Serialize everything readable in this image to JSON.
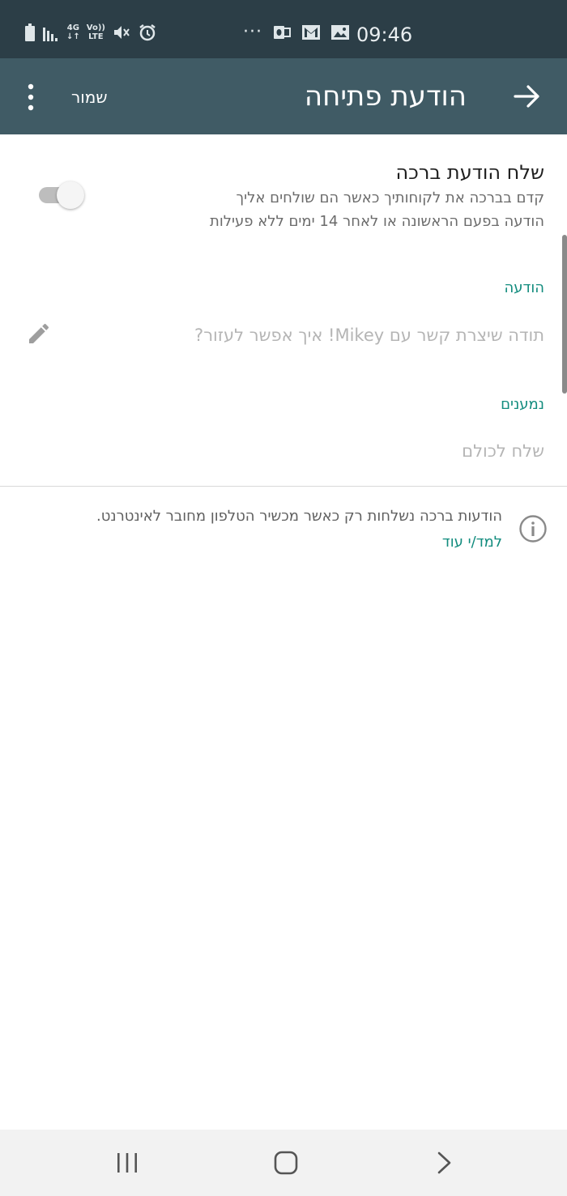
{
  "status_bar": {
    "time": "09:46",
    "network_label": "4G",
    "volte_label": "Vo))\nLTE",
    "icons": [
      "battery-icon",
      "signal-icon",
      "network-icon",
      "volte-icon",
      "mute-icon",
      "alarm-icon",
      "more-notifications-icon",
      "outlook-icon",
      "gmail-icon",
      "gallery-icon"
    ],
    "dots": "···"
  },
  "toolbar": {
    "title": "הודעת פתיחה",
    "save_label": "שמור",
    "background": "#405b65"
  },
  "greeting_setting": {
    "title": "שלח הודעת ברכה",
    "description": "קדם בברכה את לקוחותיך כאשר הם שולחים אליך הודעה בפעם הראשונה או לאחר 14 ימים ללא פעילות",
    "enabled": false
  },
  "message_section": {
    "label": "הודעה",
    "text": "תודה שיצרת קשר עם Mikey! איך אפשר לעזור?"
  },
  "recipients_section": {
    "label": "נמענים",
    "value": "שלח לכולם"
  },
  "info": {
    "text": "הודעות ברכה נשלחות רק כאשר מכשיר הטלפון מחובר לאינטרנט.",
    "learn_more": "למד/י עוד"
  },
  "colors": {
    "accent": "#128c7e",
    "status_bar": "#2c3e47"
  }
}
